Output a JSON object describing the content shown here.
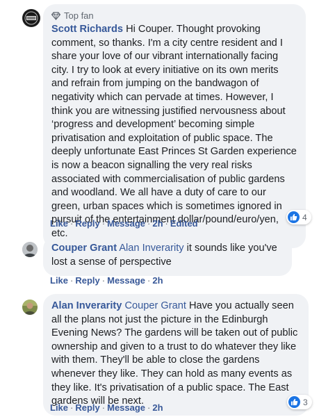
{
  "comments": [
    {
      "badge": "Top fan",
      "author": "Scott Richards",
      "text": "Hi Couper. Thought provoking comment, so thanks. I'm a city centre resident and I share your love of our vibrant internationally facing city. I try to look at every initiative on its own merits and refrain from jumping on the bandwagon of negativity which can pervade at times. However, I think you are witnessing justified nervousness about ‘progress and development’ becoming simple privatisation and exploitation of public space. The deeply unfortunate East Princes St Garden experience is now a beacon signalling the very real risks associated with commercialisation of public gardens and woodland. We all have a duty of care to our green, urban spaces which is sometimes ignored in pursuit of the entertainment dollar/pound/euro/yen, etc.",
      "actions": {
        "like": "Like",
        "reply": "Reply",
        "message": "Message",
        "time": "2h",
        "edited": "Edited"
      },
      "reactions": "4"
    },
    {
      "author": "Couper Grant",
      "mention": "Alan Inverarity",
      "text": "it sounds like you've lost a sense of perspective",
      "actions": {
        "like": "Like",
        "reply": "Reply",
        "message": "Message",
        "time": "2h"
      }
    },
    {
      "author": "Alan Inverarity",
      "mention": "Couper Grant",
      "text": "Have you actually seen all the plans not just the picture in the Edinburgh Evening News? The gardens will be taken out of public ownership and given to a trust to do whatever they like with them. They'll be able to close the gardens whenever they like. They can hold as many events as they like. It's privatisation of a public space. The East gardens will be next.",
      "actions": {
        "like": "Like",
        "reply": "Reply",
        "message": "Message",
        "time": "2h"
      },
      "reactions": "3"
    }
  ],
  "separator": "·",
  "colors": {
    "link": "#365899",
    "bubble": "#f0f2f5",
    "like_blue": "#1b74e4",
    "meta": "#606770"
  },
  "icons": {
    "badge": "diamond-icon",
    "reaction": "thumbs-up-icon"
  }
}
